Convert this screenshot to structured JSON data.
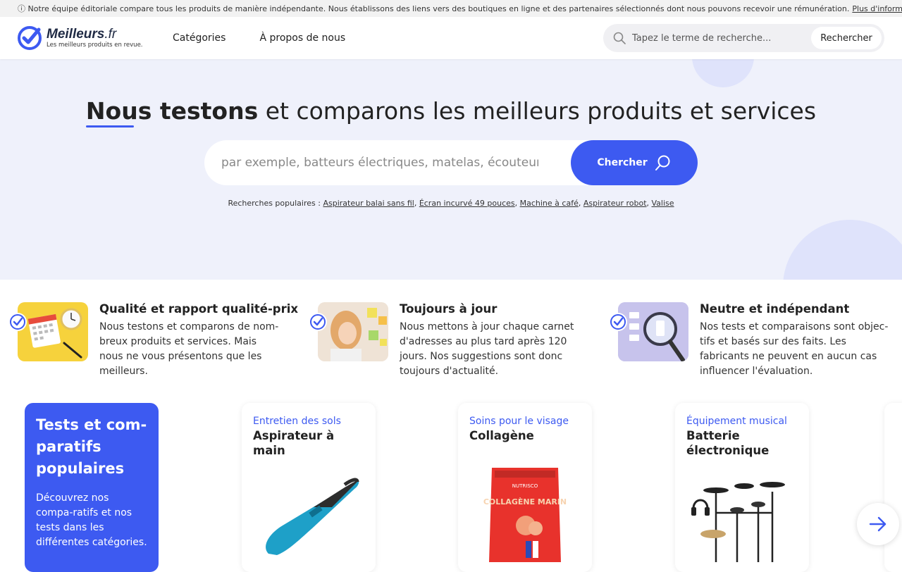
{
  "topbar": {
    "text": "ⓘ Notre équipe éditoriale compare tous les produits de manière indépendante. Nous établissons des liens vers des boutiques en ligne et des partenaires sélectionnés dont nous pouvons recevoir une rémunération.",
    "link": "Plus d'informations"
  },
  "header": {
    "logo_name": "Meilleurs",
    "logo_tld": ".fr",
    "logo_tagline": "Les meilleurs produits en revue.",
    "nav": [
      "Catégories",
      "À propos de nous"
    ],
    "search_placeholder": "Tapez le terme de recherche...",
    "search_button": "Rechercher"
  },
  "hero": {
    "title_bold": "Nous testons",
    "title_rest": " et comparons les meilleurs produits et services",
    "search_placeholder": "par exemple, batteurs électriques, matelas, écouteurs",
    "search_button": "Chercher",
    "popular_label": "Recherches populaires :",
    "popular": [
      "Aspirateur balai sans fil",
      "Écran incurvé 49 pouces",
      "Machine à café",
      "Aspirateur robot",
      "Valise"
    ],
    "accent_color": "#3d5af1",
    "bg_color": "#eff1fb"
  },
  "features": [
    {
      "title": "Qualité et rapport qualité-prix",
      "text": "Nous testons et comparons de nom-breux produits et services. Mais nous ne vous présentons que les meilleurs.",
      "image": "calendar-clock-image"
    },
    {
      "title": "Toujours à jour",
      "text": "Nous mettons à jour chaque carnet d'adresses au plus tard après 120 jours. Nos suggestions sont donc toujours d'actualité.",
      "image": "woman-sticky-notes-image"
    },
    {
      "title": "Neutre et indépendant",
      "text": "Nos tests et comparaisons sont objec-tifs et basés sur des faits. Les fabricants ne peuvent en aucun cas influencer l'évaluation.",
      "image": "magnifier-checklist-image"
    }
  ],
  "promo": {
    "title": "Tests et com-paratifs populaires",
    "text": "Découvrez nos compa-ratifs et nos tests dans les différentes catégories."
  },
  "cards": [
    {
      "category": "Entretien des sols",
      "title": "Aspirateur à main",
      "image": "handheld-vacuum-image"
    },
    {
      "category": "Soins pour le visage",
      "title": "Collagène",
      "image": "collagen-pouch-image",
      "pouch_label": "COLLAGÈNE MARIN",
      "pouch_brand": "NUTRISCO"
    },
    {
      "category": "Équipement musical",
      "title": "Batterie électronique",
      "image": "electronic-drum-kit-image"
    }
  ]
}
